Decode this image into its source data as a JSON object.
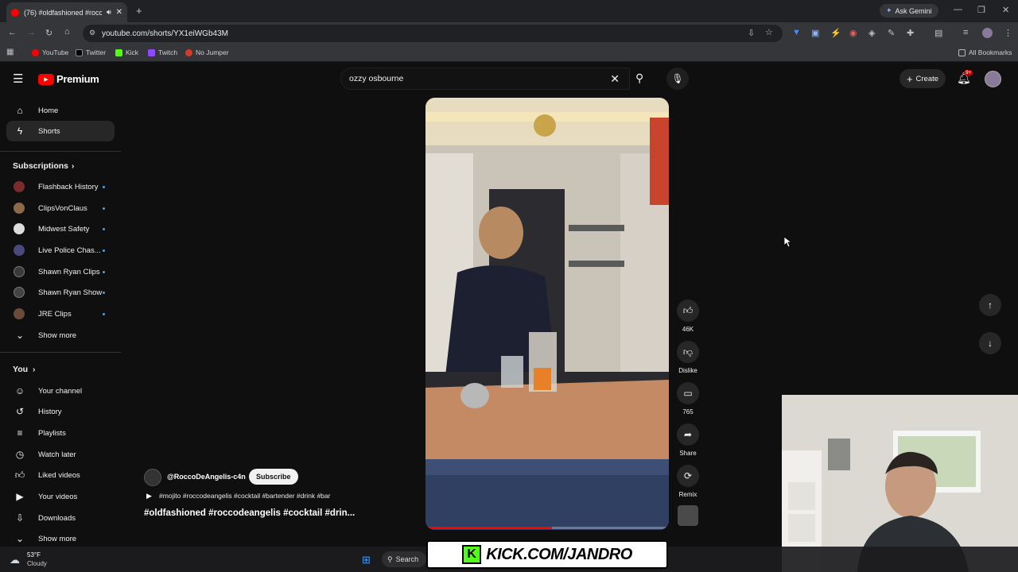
{
  "browser": {
    "tab_title": "(76) #oldfashioned #roccod",
    "url": "youtube.com/shorts/YX1eiWGb43M",
    "ask_gemini": "Ask Gemini",
    "bookmarks": [
      "YouTube",
      "Twitter",
      "Kick",
      "Twitch",
      "No Jumper"
    ],
    "all_bookmarks": "All Bookmarks"
  },
  "header": {
    "logo_text": "Premium",
    "search_value": "ozzy osbourne",
    "create_label": "Create",
    "notif_badge": "9+"
  },
  "sidebar": {
    "home": "Home",
    "shorts": "Shorts",
    "subscriptions_title": "Subscriptions",
    "subscriptions": [
      {
        "label": "Flashback History",
        "color": "#7a2b2b"
      },
      {
        "label": "ClipsVonClaus",
        "color": "#8a6a4a"
      },
      {
        "label": "Midwest Safety",
        "color": "#dddddd"
      },
      {
        "label": "Live Police Chas...",
        "color": "#4a4a7a"
      },
      {
        "label": "Shawn Ryan Clips",
        "color": "#3a3a3a"
      },
      {
        "label": "Shawn Ryan Show",
        "color": "#444444"
      },
      {
        "label": "JRE Clips",
        "color": "#6a4a3a"
      }
    ],
    "show_more_1": "Show more",
    "you_title": "You",
    "you_items": [
      "Your channel",
      "History",
      "Playlists",
      "Watch later",
      "Liked videos",
      "Your videos",
      "Downloads"
    ],
    "show_more_2": "Show more"
  },
  "short": {
    "channel": "@RoccoDeAngelis-c4n",
    "subscribe_label": "Subscribe",
    "tags": "#mojito #roccodeangelis #cocktail #bartender #drink #bar",
    "title": "#oldfashioned #roccodeangelis #cocktail #drin...",
    "like_count": "46K",
    "dislike_label": "Dislike",
    "comment_count": "765",
    "share_label": "Share",
    "remix_label": "Remix"
  },
  "overlay": {
    "kick_banner": "KICK.COM/JANDRO"
  },
  "taskbar": {
    "weather_temp": "53°F",
    "weather_cond": "Cloudy",
    "search_label": "Search"
  }
}
